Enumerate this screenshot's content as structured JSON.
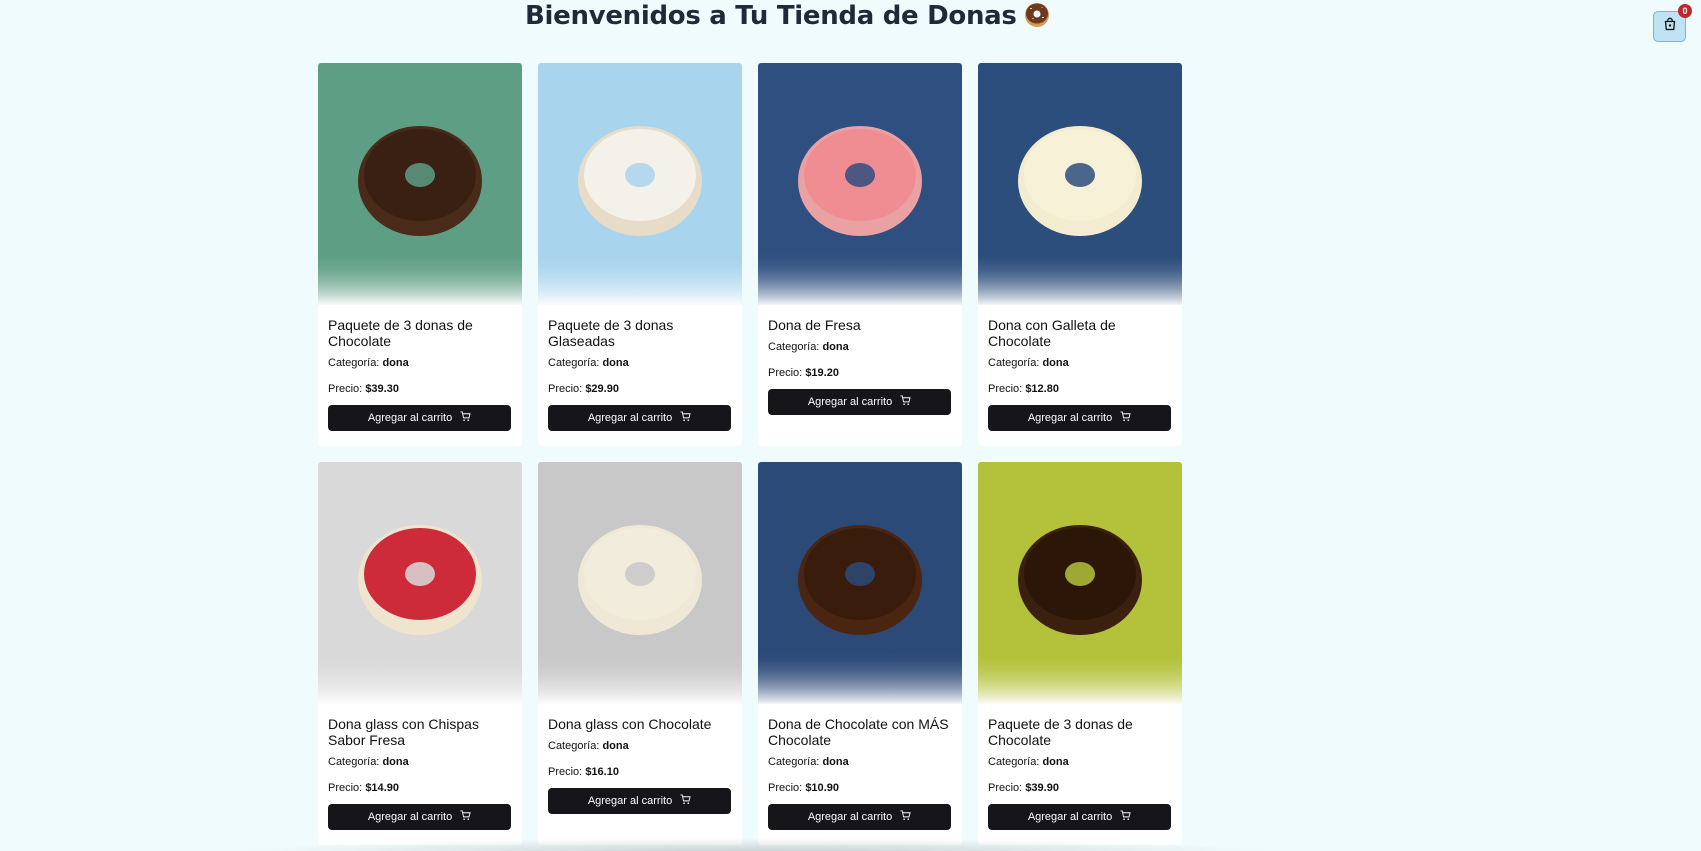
{
  "header": {
    "title": "Bienvenidos a Tu Tienda de Donas"
  },
  "cart": {
    "icon": "shopping-bag-icon",
    "count": "0"
  },
  "labels": {
    "category_prefix": "Categoría:",
    "price_prefix": "Precio:",
    "add_to_cart": "Agregar al carrito",
    "add_icon": "cart-icon"
  },
  "products": [
    {
      "name": "Paquete de 3 donas de Chocolate",
      "category": "dona",
      "price": "$39.30",
      "image_bg": "#5e9e85",
      "donut": "#4a2a18",
      "glaze": "#3a2012"
    },
    {
      "name": "Paquete de 3 donas Glaseadas",
      "category": "dona",
      "price": "$29.90",
      "image_bg": "#a9d4ee",
      "donut": "#e6dcc8",
      "glaze": "#f4f1ea"
    },
    {
      "name": "Dona de Fresa",
      "category": "dona",
      "price": "$19.20",
      "image_bg": "#2f4f80",
      "donut": "#e9a1a4",
      "glaze": "#ef8d92"
    },
    {
      "name": "Dona con Galleta de Chocolate",
      "category": "dona",
      "price": "$12.80",
      "image_bg": "#2c4e7c",
      "donut": "#f3ecd0",
      "glaze": "#f7f1d8"
    },
    {
      "name": "Dona glass con Chispas Sabor Fresa",
      "category": "dona",
      "price": "$14.90",
      "image_bg": "#d9d9d9",
      "donut": "#efe5cf",
      "glaze": "#cd2a3a"
    },
    {
      "name": "Dona glass con Chocolate",
      "category": "dona",
      "price": "$16.10",
      "image_bg": "#c8c8c8",
      "donut": "#efe8d7",
      "glaze": "#f2ecdc"
    },
    {
      "name": "Dona de Chocolate con MÁS Chocolate",
      "category": "dona",
      "price": "$10.90",
      "image_bg": "#2c4a78",
      "donut": "#4a2612",
      "glaze": "#3a1c0c"
    },
    {
      "name": "Paquete de 3 donas de Chocolate",
      "category": "dona",
      "price": "$39.90",
      "image_bg": "#b3c23a",
      "donut": "#3b2010",
      "glaze": "#2c1608"
    }
  ]
}
